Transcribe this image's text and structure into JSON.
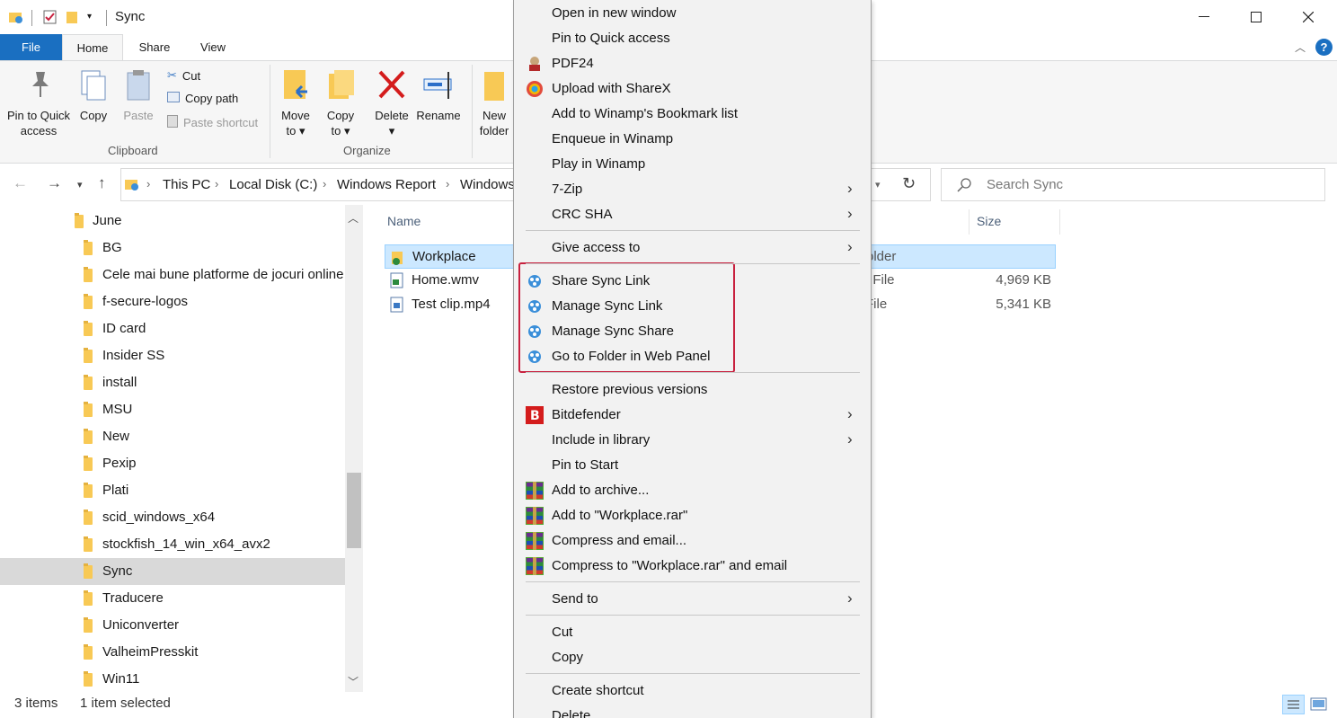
{
  "window": {
    "title": "Sync",
    "controls": {
      "minimize": "—",
      "maximize": "☐",
      "close": "✕"
    }
  },
  "ribbon": {
    "tabs": [
      "File",
      "Home",
      "Share",
      "View"
    ],
    "clipboard": {
      "pin_label_1": "Pin to Quick",
      "pin_label_2": "access",
      "copy": "Copy",
      "paste": "Paste",
      "cut": "Cut",
      "copy_path": "Copy path",
      "paste_shortcut": "Paste shortcut",
      "group": "Clipboard"
    },
    "organize": {
      "move_to_1": "Move",
      "move_to_2": "to",
      "copy_to_1": "Copy",
      "copy_to_2": "to",
      "delete": "Delete",
      "rename": "Rename",
      "group": "Organize"
    },
    "new": {
      "new_folder_1": "New",
      "new_folder_2": "folder"
    }
  },
  "address": {
    "crumbs": [
      "This PC",
      "Local Disk (C:)",
      "Windows Report",
      "Windows"
    ],
    "search_placeholder": "Search Sync"
  },
  "nav_tree": {
    "items": [
      {
        "label": "June",
        "selected": false,
        "indent": 0
      },
      {
        "label": "BG",
        "selected": false,
        "indent": 1
      },
      {
        "label": "Cele mai bune platforme de jocuri online",
        "selected": false,
        "indent": 1
      },
      {
        "label": "f-secure-logos",
        "selected": false,
        "indent": 1
      },
      {
        "label": "ID card",
        "selected": false,
        "indent": 1
      },
      {
        "label": "Insider SS",
        "selected": false,
        "indent": 1
      },
      {
        "label": "install",
        "selected": false,
        "indent": 1
      },
      {
        "label": "MSU",
        "selected": false,
        "indent": 1
      },
      {
        "label": "New",
        "selected": false,
        "indent": 1
      },
      {
        "label": "Pexip",
        "selected": false,
        "indent": 1
      },
      {
        "label": "Plati",
        "selected": false,
        "indent": 1
      },
      {
        "label": "scid_windows_x64",
        "selected": false,
        "indent": 1
      },
      {
        "label": "stockfish_14_win_x64_avx2",
        "selected": false,
        "indent": 1
      },
      {
        "label": "Sync",
        "selected": true,
        "indent": 1
      },
      {
        "label": "Traducere",
        "selected": false,
        "indent": 1
      },
      {
        "label": "Uniconverter",
        "selected": false,
        "indent": 1
      },
      {
        "label": "ValheimPresskit",
        "selected": false,
        "indent": 1
      },
      {
        "label": "Win11",
        "selected": false,
        "indent": 1
      }
    ]
  },
  "file_list": {
    "columns": {
      "name": "Name",
      "size": "Size"
    },
    "rows": [
      {
        "name": "Workplace",
        "type": "older",
        "size": "",
        "selected": true
      },
      {
        "name": "Home.wmv",
        "type": "/ File",
        "size": "4,969 KB",
        "selected": false
      },
      {
        "name": "Test clip.mp4",
        "type": "File",
        "size": "5,341 KB",
        "selected": false
      }
    ]
  },
  "status": {
    "items": "3 items",
    "selected": "1 item selected"
  },
  "context_menu": {
    "items": [
      {
        "label": "Open in new window",
        "icon": "",
        "submenu": false
      },
      {
        "label": "Pin to Quick access",
        "icon": "",
        "submenu": false
      },
      {
        "label": "PDF24",
        "icon": "pdf24-icon",
        "submenu": false
      },
      {
        "label": "Upload with ShareX",
        "icon": "sharex-icon",
        "submenu": false
      },
      {
        "label": "Add to Winamp's Bookmark list",
        "icon": "",
        "submenu": false
      },
      {
        "label": "Enqueue in Winamp",
        "icon": "",
        "submenu": false
      },
      {
        "label": "Play in Winamp",
        "icon": "",
        "submenu": false
      },
      {
        "label": "7-Zip",
        "icon": "",
        "submenu": true
      },
      {
        "label": "CRC SHA",
        "icon": "",
        "submenu": true
      },
      {
        "label": "Give access to",
        "icon": "",
        "submenu": true
      },
      {
        "label": "Share Sync Link",
        "icon": "sync-icon",
        "submenu": false
      },
      {
        "label": "Manage Sync Link",
        "icon": "sync-icon",
        "submenu": false
      },
      {
        "label": "Manage Sync Share",
        "icon": "sync-icon",
        "submenu": false
      },
      {
        "label": "Go to Folder in Web Panel",
        "icon": "sync-icon",
        "submenu": false
      },
      {
        "label": "Restore previous versions",
        "icon": "",
        "submenu": false
      },
      {
        "label": "Bitdefender",
        "icon": "bitdefender-icon",
        "submenu": true
      },
      {
        "label": "Include in library",
        "icon": "",
        "submenu": true
      },
      {
        "label": "Pin to Start",
        "icon": "",
        "submenu": false
      },
      {
        "label": "Add to archive...",
        "icon": "winrar-icon",
        "submenu": false
      },
      {
        "label": "Add to \"Workplace.rar\"",
        "icon": "winrar-icon",
        "submenu": false
      },
      {
        "label": "Compress and email...",
        "icon": "winrar-icon",
        "submenu": false
      },
      {
        "label": "Compress to \"Workplace.rar\" and email",
        "icon": "winrar-icon",
        "submenu": false
      },
      {
        "label": "Send to",
        "icon": "",
        "submenu": true
      },
      {
        "label": "Cut",
        "icon": "",
        "submenu": false
      },
      {
        "label": "Copy",
        "icon": "",
        "submenu": false
      },
      {
        "label": "Create shortcut",
        "icon": "",
        "submenu": false
      },
      {
        "label": "Delete",
        "icon": "",
        "submenu": false
      }
    ]
  },
  "colors": {
    "accent": "#1a6fc1",
    "highlight_box": "#c8213f",
    "selection": "#cce8ff"
  }
}
